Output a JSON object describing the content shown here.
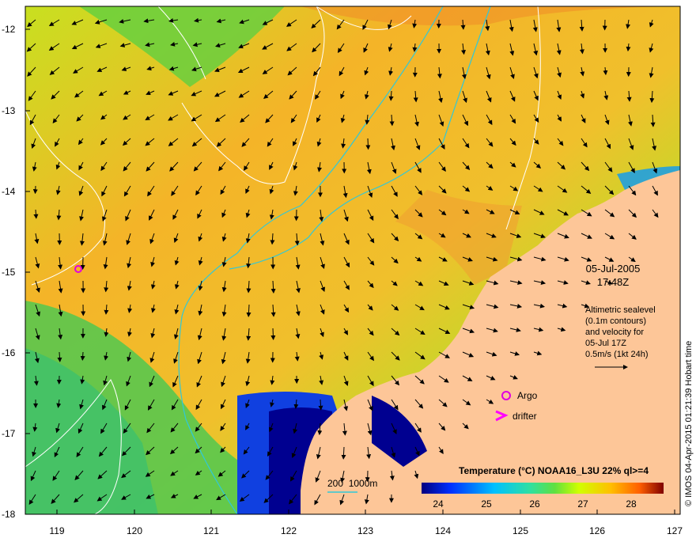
{
  "map": {
    "y_axis_ticks": [
      "-12",
      "-13",
      "-14",
      "-15",
      "-16",
      "-17",
      "-18"
    ],
    "x_axis_ticks": [
      "119",
      "120",
      "121",
      "122",
      "123",
      "124",
      "125",
      "126",
      "127"
    ],
    "date": "05-Jul-2005",
    "time": "17:48Z",
    "info_lines": [
      "Altimetric sealevel",
      "(0.1m contours)",
      "and velocity for",
      "05-Jul 17Z",
      "0.5m/s (1kt 24h)"
    ],
    "credit": "© IMOS 04-Apr-2015 01:21:39 Hobart time",
    "legend": {
      "argo": "Argo",
      "drifter": "drifter",
      "isobaths": "200  1000m"
    },
    "colorbar_title": "Temperature (°C) NOAA16_L3U 22% ql>=4",
    "colorbar_ticks": [
      "24",
      "25",
      "26",
      "27",
      "28"
    ],
    "colors": {
      "land": "#fdc698",
      "contour": "#ffffff",
      "isobath": "#30c8d8",
      "argo": "#e000e0",
      "drifter": "#ff00ff"
    }
  }
}
